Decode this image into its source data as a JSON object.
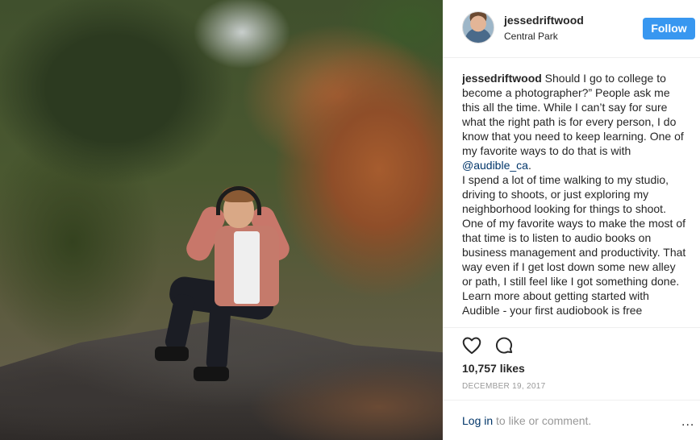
{
  "post": {
    "username": "jessedriftwood",
    "location": "Central Park",
    "follow_label": "Follow",
    "caption": {
      "username": "jessedriftwood",
      "text_before_mention": " Should I go to college to become a photographer?” People ask me this all the time. While I can’t say for sure what the right path is for every person, I do know that you need to keep learning. One of my favorite ways to do that is with ",
      "mention": "@audible_ca",
      "text_after_mention": ".\nI spend a lot of time walking to my studio, driving to shoots, or just exploring my neighborhood looking for things to shoot. One of my favorite ways to make the most of that time is to listen to audio books on business management and productivity. That way even if I get lost down some new alley or path, I still feel like I got something done. Learn more about getting started with Audible - your first audiobook is free"
    },
    "likes": "10,757 likes",
    "date": "DECEMBER 19, 2017",
    "login_link": "Log in",
    "login_text": " to like or comment.",
    "more_label": "...",
    "icons": {
      "like": "heart-icon",
      "comment": "comment-bubble-icon",
      "more": "more-options-icon"
    },
    "colors": {
      "follow_button": "#3897f0",
      "link": "#003569",
      "muted": "#999999"
    }
  }
}
